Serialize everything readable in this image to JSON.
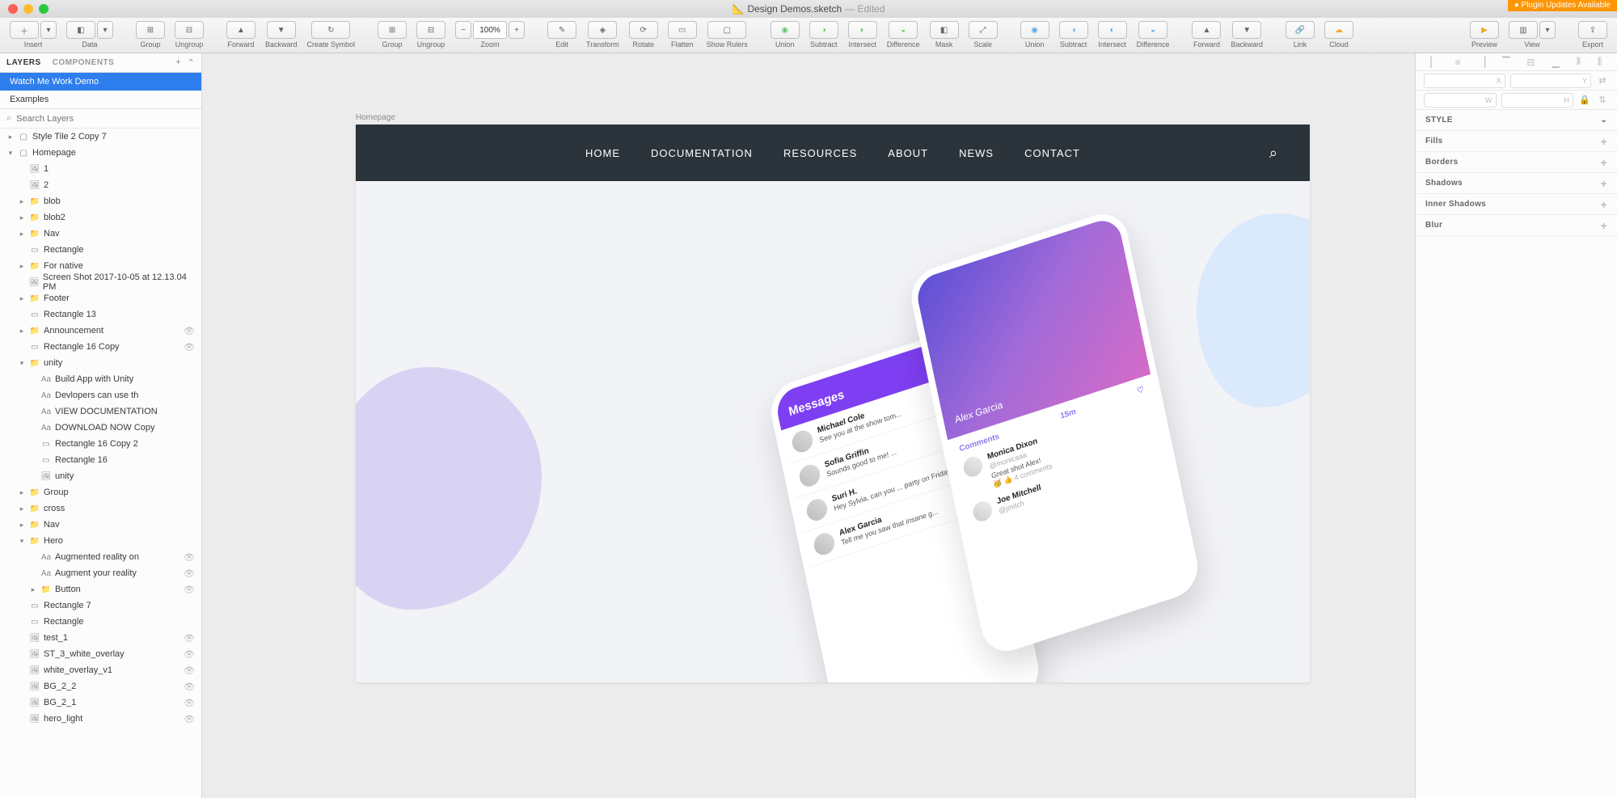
{
  "titlebar": {
    "filename": "Design Demos.sketch",
    "edited": "— Edited",
    "plugin_banner": "● Plugin Updates Available"
  },
  "toolbar": {
    "insert": "Insert",
    "data": "Data",
    "group": "Group",
    "ungroup": "Ungroup",
    "forward": "Forward",
    "backward": "Backward",
    "create_symbol": "Create Symbol",
    "group2": "Group",
    "ungroup2": "Ungroup",
    "zoom": "Zoom",
    "zoom_value": "100%",
    "edit": "Edit",
    "transform": "Transform",
    "rotate": "Rotate",
    "flatten": "Flatten",
    "show_rulers": "Show Rulers",
    "union": "Union",
    "subtract": "Subtract",
    "intersect": "Intersect",
    "difference": "Difference",
    "mask": "Mask",
    "scale": "Scale",
    "union2": "Union",
    "subtract2": "Subtract",
    "intersect2": "Intersect",
    "difference2": "Difference",
    "forward2": "Forward",
    "backward2": "Backward",
    "link": "Link",
    "cloud": "Cloud",
    "preview": "Preview",
    "view": "View",
    "export": "Export"
  },
  "left_panel": {
    "tab_layers": "LAYERS",
    "tab_components": "COMPONENTS",
    "pages": [
      "Watch Me Work Demo",
      "Examples"
    ],
    "search_placeholder": "Search Layers",
    "layers": [
      {
        "ind": 1,
        "disc": "▸",
        "icon": "artboard",
        "name": "Style Tile 2 Copy 7"
      },
      {
        "ind": 1,
        "disc": "▾",
        "icon": "artboard",
        "name": "Homepage"
      },
      {
        "ind": 2,
        "disc": "",
        "icon": "image",
        "name": "1"
      },
      {
        "ind": 2,
        "disc": "",
        "icon": "image",
        "name": "2"
      },
      {
        "ind": 2,
        "disc": "▸",
        "icon": "folder",
        "name": "blob"
      },
      {
        "ind": 2,
        "disc": "▸",
        "icon": "folder",
        "name": "blob2"
      },
      {
        "ind": 2,
        "disc": "▸",
        "icon": "folder",
        "name": "Nav"
      },
      {
        "ind": 2,
        "disc": "",
        "icon": "rect",
        "name": "Rectangle"
      },
      {
        "ind": 2,
        "disc": "▸",
        "icon": "folder",
        "name": "For native"
      },
      {
        "ind": 2,
        "disc": "",
        "icon": "image",
        "name": "Screen Shot 2017-10-05 at 12.13.04 PM"
      },
      {
        "ind": 2,
        "disc": "▸",
        "icon": "folder",
        "name": "Footer"
      },
      {
        "ind": 2,
        "disc": "",
        "icon": "rect",
        "name": "Rectangle 13"
      },
      {
        "ind": 2,
        "disc": "▸",
        "icon": "folder",
        "name": "Announcement",
        "hidden": true
      },
      {
        "ind": 2,
        "disc": "",
        "icon": "rect",
        "name": "Rectangle 16 Copy",
        "hidden": true
      },
      {
        "ind": 2,
        "disc": "▾",
        "icon": "folder",
        "name": "unity"
      },
      {
        "ind": 3,
        "disc": "",
        "icon": "text",
        "name": "Build App with Unity"
      },
      {
        "ind": 3,
        "disc": "",
        "icon": "text",
        "name": "Devlopers can use th"
      },
      {
        "ind": 3,
        "disc": "",
        "icon": "text",
        "name": "VIEW DOCUMENTATION"
      },
      {
        "ind": 3,
        "disc": "",
        "icon": "text",
        "name": "DOWNLOAD NOW Copy"
      },
      {
        "ind": 3,
        "disc": "",
        "icon": "rect",
        "name": "Rectangle 16 Copy 2"
      },
      {
        "ind": 3,
        "disc": "",
        "icon": "rect",
        "name": "Rectangle 16"
      },
      {
        "ind": 3,
        "disc": "",
        "icon": "image",
        "name": "unity"
      },
      {
        "ind": 2,
        "disc": "▸",
        "icon": "folder",
        "name": "Group"
      },
      {
        "ind": 2,
        "disc": "▸",
        "icon": "folder",
        "name": "cross"
      },
      {
        "ind": 2,
        "disc": "▸",
        "icon": "folder",
        "name": "Nav"
      },
      {
        "ind": 2,
        "disc": "▾",
        "icon": "folder",
        "name": "Hero"
      },
      {
        "ind": 3,
        "disc": "",
        "icon": "text",
        "name": "Augmented reality on",
        "hidden": true
      },
      {
        "ind": 3,
        "disc": "",
        "icon": "text",
        "name": "Augment your reality",
        "hidden": true
      },
      {
        "ind": 3,
        "disc": "▸",
        "icon": "folder",
        "name": "Button",
        "hidden": true
      },
      {
        "ind": 2,
        "disc": "",
        "icon": "rect",
        "name": "Rectangle 7"
      },
      {
        "ind": 2,
        "disc": "",
        "icon": "rect",
        "name": "Rectangle"
      },
      {
        "ind": 2,
        "disc": "",
        "icon": "image",
        "name": "test_1",
        "hidden": true
      },
      {
        "ind": 2,
        "disc": "",
        "icon": "image",
        "name": "ST_3_white_overlay",
        "hidden": true
      },
      {
        "ind": 2,
        "disc": "",
        "icon": "image",
        "name": "white_overlay_v1",
        "hidden": true
      },
      {
        "ind": 2,
        "disc": "",
        "icon": "image",
        "name": "BG_2_2",
        "hidden": true
      },
      {
        "ind": 2,
        "disc": "",
        "icon": "image",
        "name": "BG_2_1",
        "hidden": true
      },
      {
        "ind": 2,
        "disc": "",
        "icon": "image",
        "name": "hero_light",
        "hidden": true
      }
    ]
  },
  "right_panel": {
    "style_header": "STYLE",
    "fills": "Fills",
    "borders": "Borders",
    "shadows": "Shadows",
    "inner_shadows": "Inner Shadows",
    "blur": "Blur",
    "x_label": "X",
    "y_label": "Y",
    "w_label": "W",
    "h_label": "H"
  },
  "canvas": {
    "artboard_label": "Homepage",
    "nav_items": [
      "HOME",
      "DOCUMENTATION",
      "RESOURCES",
      "ABOUT",
      "NEWS",
      "CONTACT"
    ],
    "phone1_header": "Messages",
    "phone1_msgs": [
      {
        "name": "Michael Cole",
        "text": "See you at the show tom..."
      },
      {
        "name": "Sofia Griffin",
        "text": "Sounds good to me! ..."
      },
      {
        "name": "Suri H.",
        "text": "Hey Sylvia, can you ... party on Friday?"
      },
      {
        "name": "Alex Garcia",
        "text": "Tell me you saw that insane g..."
      }
    ],
    "phone2_profile": "Alex Garcia",
    "phone2_comments_label": "Comments",
    "phone2_time": "15m",
    "phone2_cmts": [
      {
        "name": "Monica Dixon",
        "handle": "@monicaaa",
        "text": "Great shot Alex!",
        "meta": "🥳 👍 4 comments"
      },
      {
        "name": "Joe Mitchell",
        "handle": "@jmitch",
        "text": ""
      }
    ]
  }
}
